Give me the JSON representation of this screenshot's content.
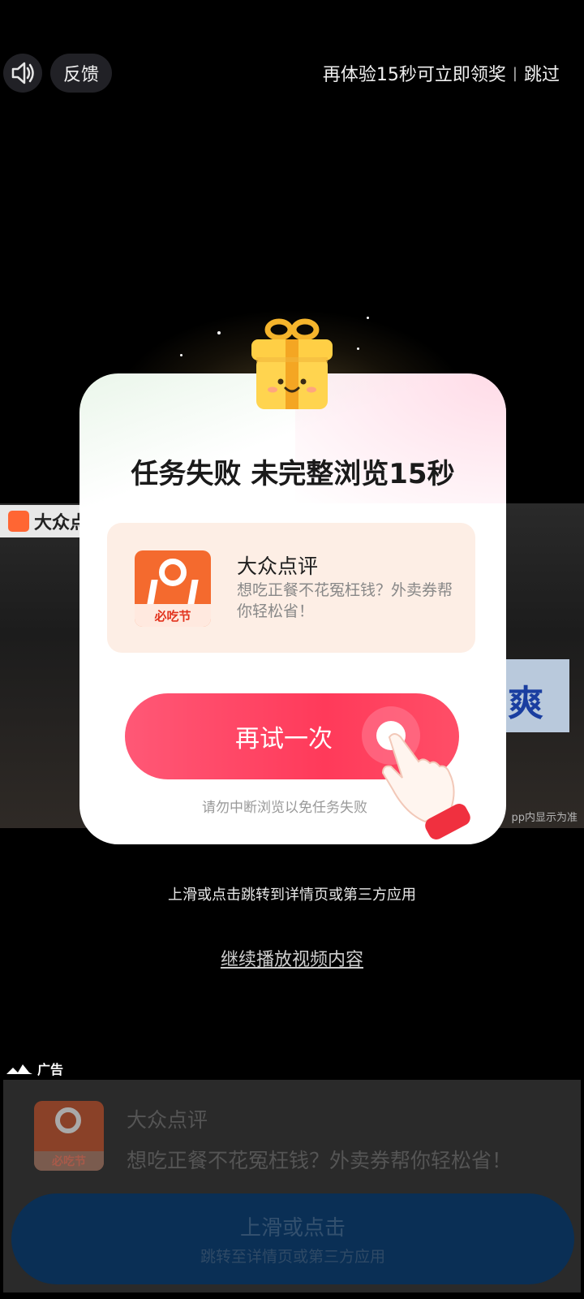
{
  "top_bar": {
    "sound_icon": "speaker-icon",
    "feedback_label": "反馈",
    "reward_hint": "再体验15秒可立即领奖",
    "separator": "|",
    "skip_label": "跳过"
  },
  "video": {
    "brand": "大众点",
    "side_tag": "爽",
    "note": "pp内显示为准"
  },
  "dialog": {
    "title": "任务失败 未完整浏览15秒",
    "app": {
      "name": "大众点评",
      "description": "想吃正餐不花冤枉钱？外卖券帮你轻松省！",
      "icon_badge": "必吃节"
    },
    "retry_label": "再试一次",
    "warning": "请勿中断浏览以免任务失败"
  },
  "swipe_hint": "上滑或点击跳转到详情页或第三方应用",
  "continue_label": "继续播放视频内容",
  "ad": {
    "label": "广告",
    "name": "大众点评",
    "description": "想吃正餐不花冤枉钱？外卖券帮你轻松省！",
    "icon_badge": "必吃节",
    "cta_main": "上滑或点击",
    "cta_sub": "跳转至详情页或第三方应用"
  },
  "colors": {
    "accent": "#ff3a5a",
    "app_orange": "#f46a2e",
    "cta_navy": "#0a2f55"
  }
}
